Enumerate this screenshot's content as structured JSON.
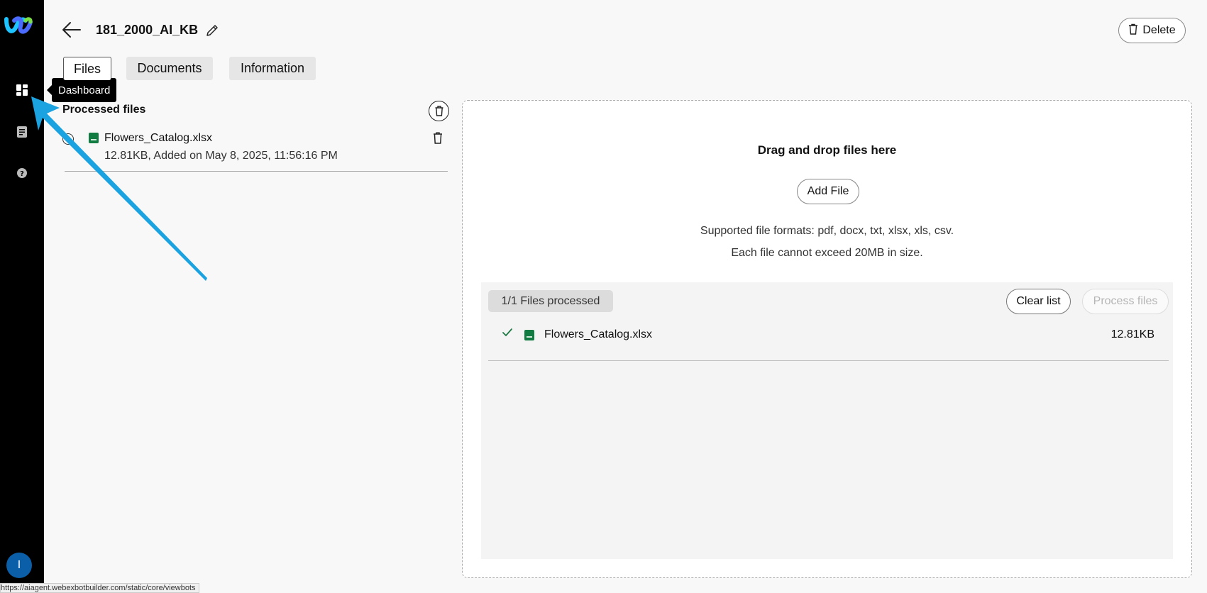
{
  "sidebar": {
    "logo_icon": "webex-logo-icon",
    "items": [
      {
        "name": "dashboard",
        "icon": "dashboard-grid-icon"
      },
      {
        "name": "documents",
        "icon": "document-icon"
      },
      {
        "name": "help",
        "icon": "help-circle-icon"
      }
    ],
    "avatar_initial": "I",
    "tooltip": "Dashboard"
  },
  "header": {
    "title": "181_2000_AI_KB",
    "delete_label": "Delete"
  },
  "tabs": [
    {
      "label": "Files",
      "active": true
    },
    {
      "label": "Documents",
      "active": false
    },
    {
      "label": "Information",
      "active": false
    }
  ],
  "processed": {
    "title": "Processed files",
    "files": [
      {
        "name": "Flowers_Catalog.xlsx",
        "meta": "12.81KB, Added on May 8, 2025, 11:56:16 PM"
      }
    ]
  },
  "dropzone": {
    "title": "Drag and drop files here",
    "add_file_label": "Add File",
    "formats": "Supported file formats: pdf, docx, txt, xlsx, xls, csv.",
    "size_limit": "Each file cannot exceed 20MB in size.",
    "queue": {
      "status": "1/1 Files processed",
      "clear_label": "Clear list",
      "process_label": "Process files",
      "files": [
        {
          "name": "Flowers_Catalog.xlsx",
          "size": "12.81KB"
        }
      ]
    }
  },
  "status_url": "https://aiagent.webexbotbuilder.com/static/core/viewbots",
  "colors": {
    "sidebar_bg": "#000000",
    "avatar": "#0b5fa8",
    "xlsx_icon": "#107c41",
    "annotation_arrow": "#1aa3e0"
  }
}
